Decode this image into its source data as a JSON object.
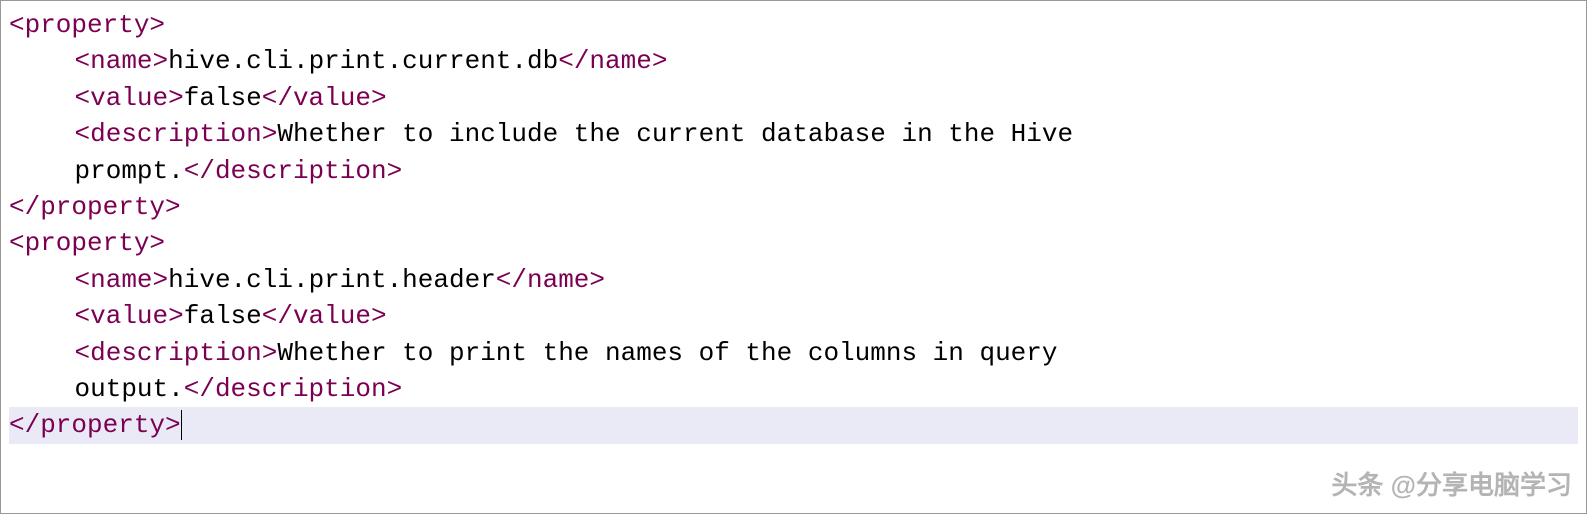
{
  "code": {
    "prop1": {
      "open": "<property>",
      "name_open": "<name>",
      "name_val": "hive.cli.print.current.db",
      "name_close": "</name>",
      "value_open": "<value>",
      "value_val": "false",
      "value_close": "</value>",
      "desc_open": "<description>",
      "desc_val_a": "Whether to include the current database in the Hive",
      "desc_val_b": "prompt.",
      "desc_close": "</description>",
      "close": "</property>"
    },
    "prop2": {
      "open": "<property>",
      "name_open": "<name>",
      "name_val": "hive.cli.print.header",
      "name_close": "</name>",
      "value_open": "<value>",
      "value_val": "false",
      "value_close": "</value>",
      "desc_open": "<description>",
      "desc_val_a": "Whether to print the names of the columns in query",
      "desc_val_b": "output.",
      "desc_close": "</description>",
      "close": "</property>"
    }
  },
  "watermark": "头条 @分享电脑学习"
}
